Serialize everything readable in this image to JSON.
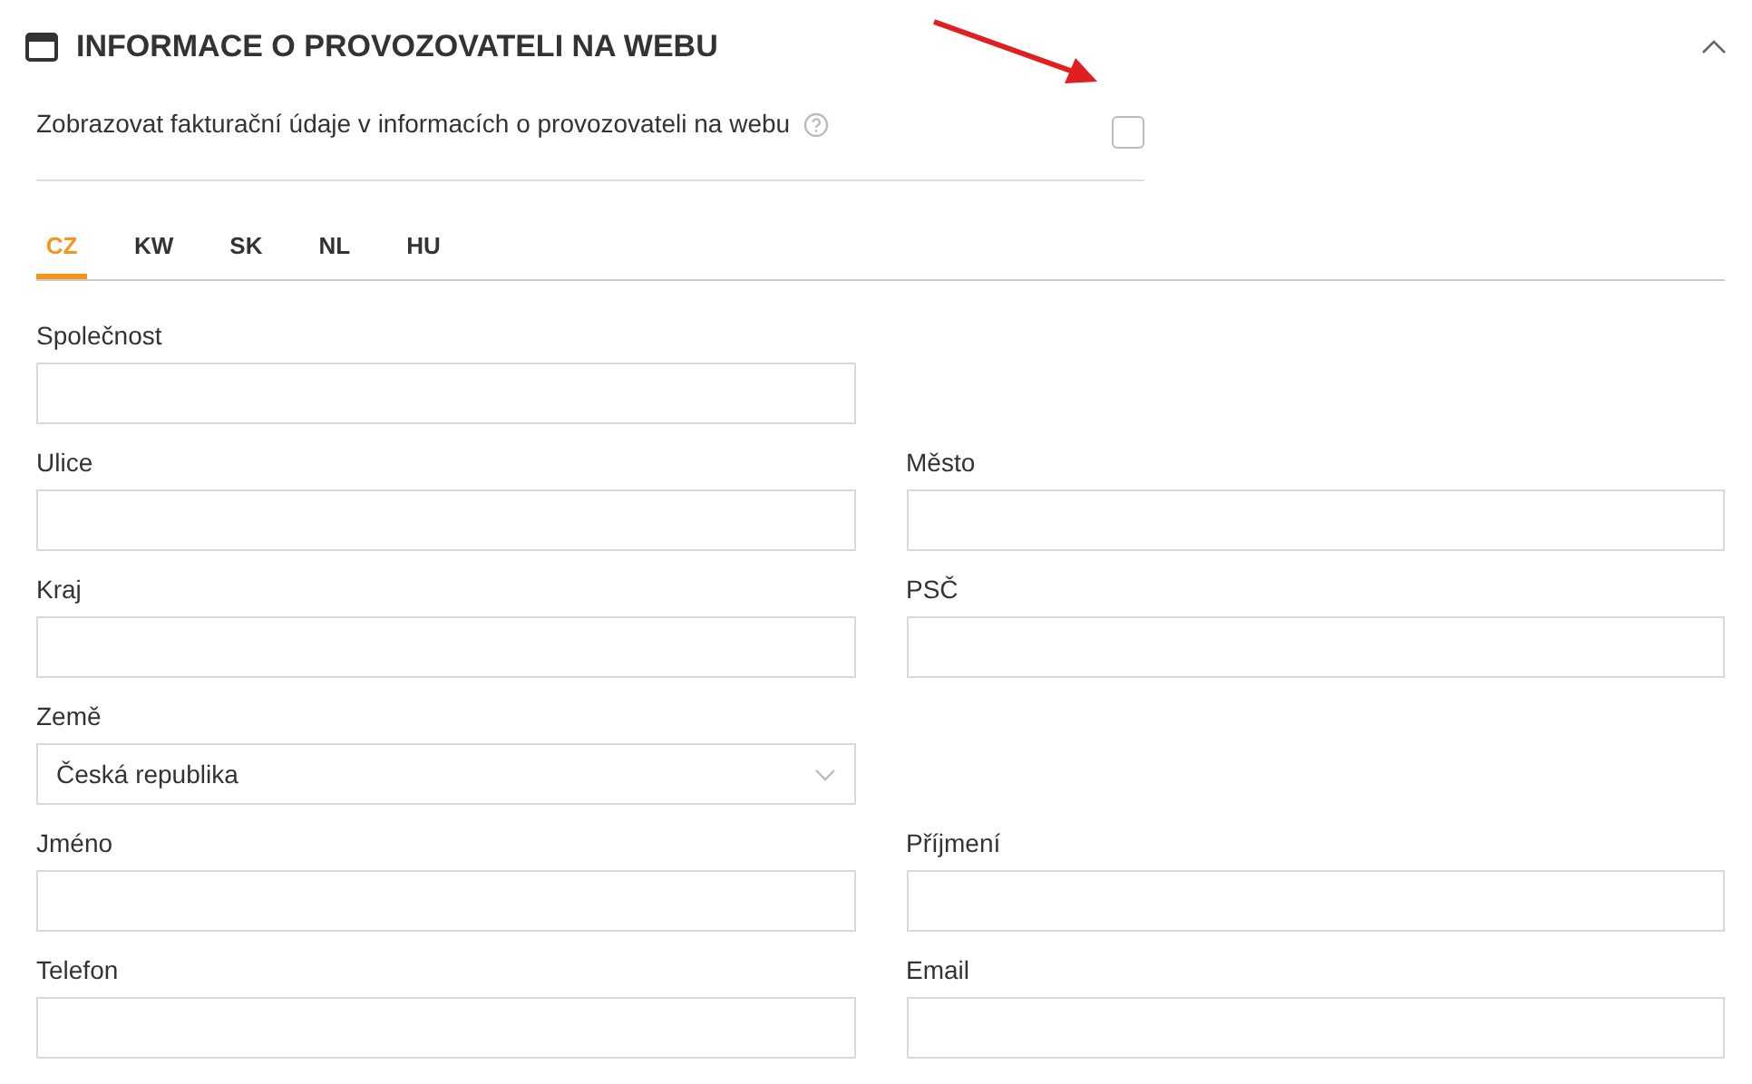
{
  "section": {
    "title": "INFORMACE O PROVOZOVATELI NA WEBU",
    "expanded": true
  },
  "option": {
    "label": "Zobrazovat fakturační údaje v informacích o provozovateli na webu",
    "checked": false
  },
  "tabs": [
    {
      "label": "CZ",
      "selected": true
    },
    {
      "label": "KW",
      "selected": false
    },
    {
      "label": "SK",
      "selected": false
    },
    {
      "label": "NL",
      "selected": false
    },
    {
      "label": "HU",
      "selected": false
    }
  ],
  "rows": [
    [
      {
        "label": "Společnost",
        "kind": "text"
      }
    ],
    [
      {
        "label": "Ulice",
        "kind": "text"
      },
      {
        "label": "Město",
        "kind": "text"
      }
    ],
    [
      {
        "label": "Kraj",
        "kind": "text"
      },
      {
        "label": "PSČ",
        "kind": "text"
      }
    ],
    [
      {
        "label": "Země",
        "kind": "select",
        "value": "Česká republika"
      }
    ],
    [
      {
        "label": "Jméno",
        "kind": "text"
      },
      {
        "label": "Příjmení",
        "kind": "text"
      }
    ],
    [
      {
        "label": "Telefon",
        "kind": "text"
      },
      {
        "label": "Email",
        "kind": "text"
      }
    ]
  ]
}
